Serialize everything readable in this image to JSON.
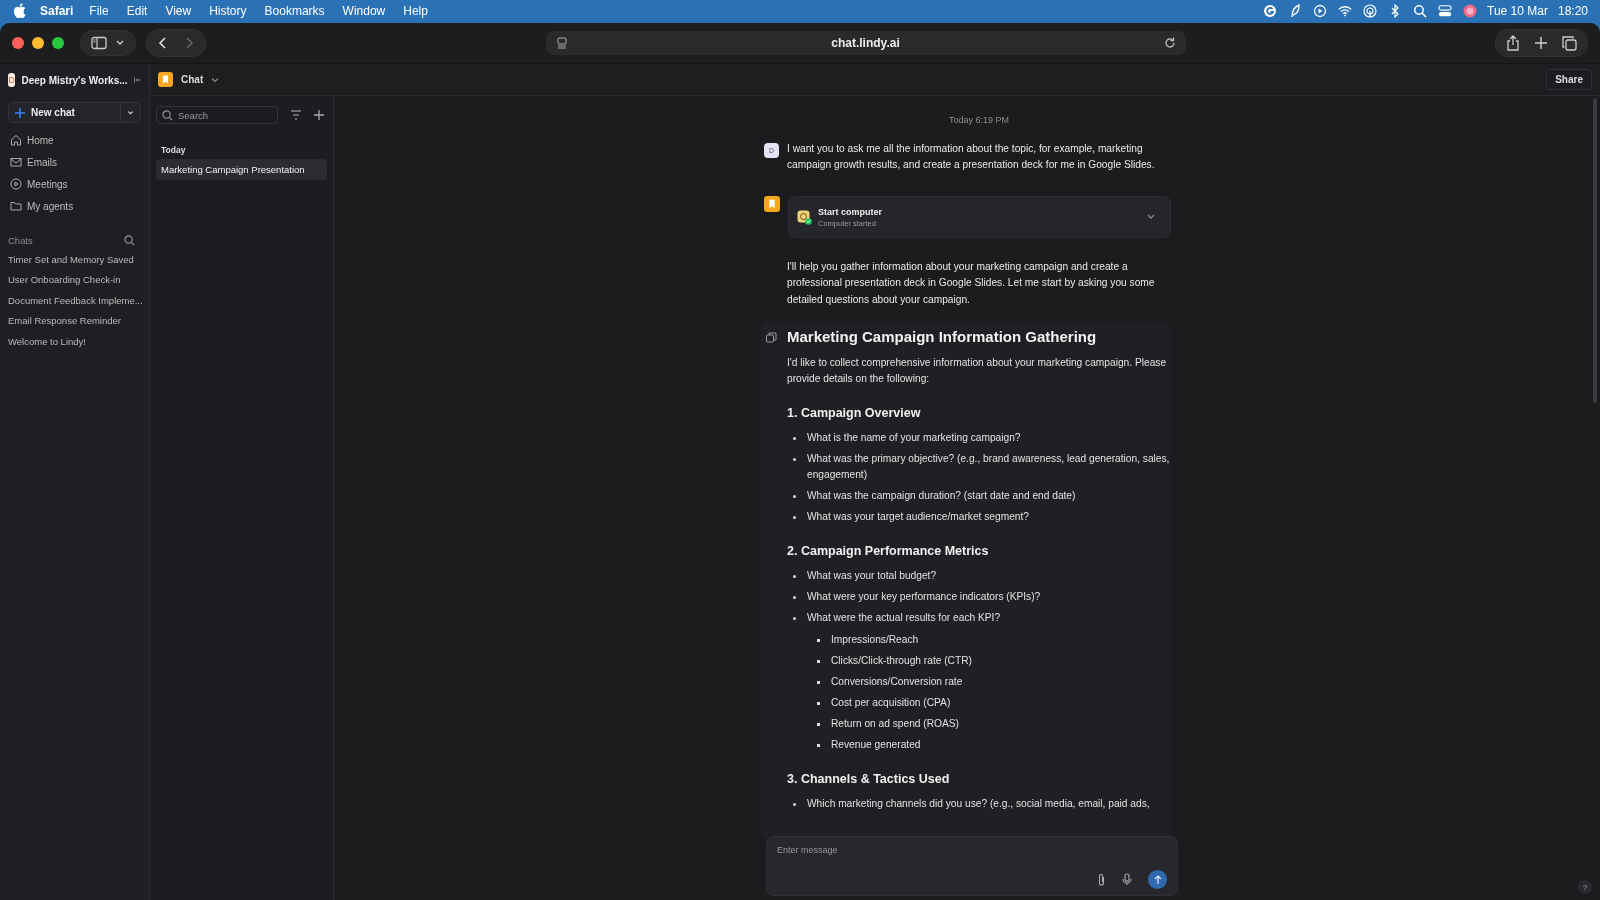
{
  "menubar": {
    "app": "Safari",
    "menus": [
      "File",
      "Edit",
      "View",
      "History",
      "Bookmarks",
      "Window",
      "Help"
    ],
    "date": "Tue 10 Mar",
    "time": "18:20"
  },
  "browser": {
    "url": "chat.lindy.ai"
  },
  "sidebar": {
    "workspace": {
      "initial": "D",
      "name": "Deep Mistry's Works..."
    },
    "new_chat": "New chat",
    "nav": [
      {
        "label": "Home",
        "kind": "home"
      },
      {
        "label": "Emails",
        "kind": "mail"
      },
      {
        "label": "Meetings",
        "kind": "play"
      },
      {
        "label": "My agents",
        "kind": "folder"
      }
    ],
    "chats_label": "Chats",
    "chats": [
      "Timer Set and Memory Saved",
      "User Onboarding Check-in",
      "Document Feedback Impleme...",
      "Email Response Reminder",
      "Welcome to Lindy!"
    ]
  },
  "panel": {
    "search": {
      "placeholder": "Search"
    },
    "group": "Today",
    "items": [
      {
        "label": "Marketing Campaign Presentation",
        "selected": true
      }
    ]
  },
  "header": {
    "title": "Chat",
    "share": "Share"
  },
  "thread": {
    "timestamp": "Today 6:19 PM",
    "user_message": {
      "avatar": "D",
      "text": "I want you to ask me all the information about the topic, for example, marketing campaign growth results, and create a presentation deck for me in Google Slides."
    },
    "tool_call": {
      "title": "Start computer",
      "subtitle": "Computer started"
    },
    "assistant_text": "I'll help you gather information about your marketing campaign and create a professional presentation deck in Google Slides. Let me start by asking you some detailed questions about your campaign.",
    "document": {
      "title": "Marketing Campaign Information Gathering",
      "intro": "I'd like to collect comprehensive information about your marketing campaign. Please provide details on the following:",
      "sections": [
        {
          "heading": "1. Campaign Overview",
          "bullets": [
            {
              "text": "What is the name of your marketing campaign?"
            },
            {
              "text": "What was the primary objective? (e.g., brand awareness, lead generation, sales, engagement)"
            },
            {
              "text": "What was the campaign duration? (start date and end date)"
            },
            {
              "text": "What was your target audience/market segment?"
            }
          ]
        },
        {
          "heading": "2. Campaign Performance Metrics",
          "bullets": [
            {
              "text": "What was your total budget?"
            },
            {
              "text": "What were your key performance indicators (KPIs)?"
            },
            {
              "text": "What were the actual results for each KPI?",
              "children": [
                {
                  "text": "Impressions/Reach"
                },
                {
                  "text": "Clicks/Click-through rate (CTR)"
                },
                {
                  "text": "Conversions/Conversion rate"
                },
                {
                  "text": "Cost per acquisition (CPA)"
                },
                {
                  "text": "Return on ad spend (ROAS)"
                },
                {
                  "text": "Revenue generated"
                }
              ]
            }
          ]
        },
        {
          "heading": "3. Channels & Tactics Used",
          "bullets": [
            {
              "text": "Which marketing channels did you use? (e.g., social media, email, paid ads,"
            }
          ]
        }
      ]
    }
  },
  "composer": {
    "placeholder": "Enter message"
  },
  "help": "?"
}
